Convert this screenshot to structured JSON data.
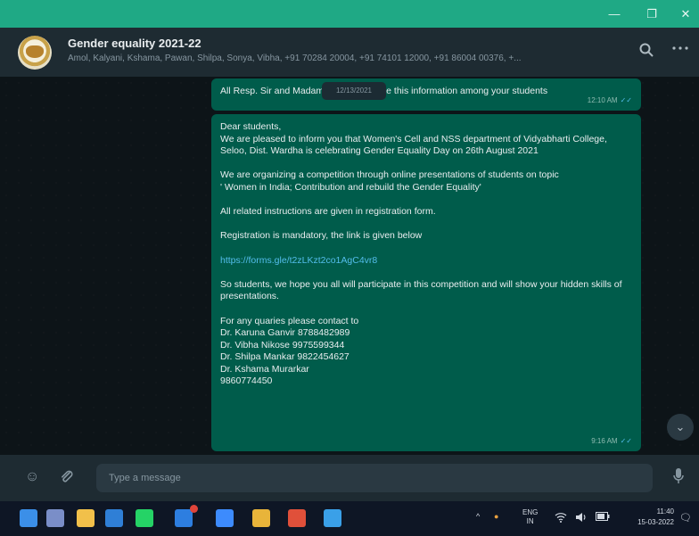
{
  "window": {
    "minimize_glyph": "—",
    "maximize_glyph": "❐",
    "close_glyph": "✕",
    "titlebar_color": "#1fa985"
  },
  "chat": {
    "title": "Gender equality 2021-22",
    "members": "Amol, Kalyani, Kshama, Pawan, Shilpa, Sonya, Vibha, +91 70284 20004, +91 74101 12000, +91 86004 00376, +...",
    "search_icon": "search-icon",
    "menu_icon": "more-options-icon"
  },
  "messages": [
    {
      "lines": [
        "All Resp. Sir and Madam please circulate this information among your students"
      ],
      "time": "12:10 AM",
      "status": "read"
    },
    {
      "lines": [
        "Dear students,",
        "We are pleased to inform you that Women's Cell and NSS department of Vidyabharti College, Seloo, Dist. Wardha is celebrating Gender Equality Day on 26th August 2021",
        "",
        "We are organizing a competition through online presentations of students on topic",
        "' Women in India; Contribution and rebuild the Gender Equality'",
        "",
        "All related instructions are given in registration form.",
        "",
        "Registration is mandatory, the link is given below",
        "",
        "https://forms.gle/t2zLKzt2co1AgC4vr8",
        "",
        "So students, we hope you all will participate in this competition and will show your hidden skills of presentations.",
        "",
        "For any quaries please contact to",
        "Dr. Karuna Ganvir 8788482989",
        "Dr. Vibha Nikose 9975599344",
        "Dr. Shilpa Mankar 9822454627",
        "Dr. Kshama Murarkar",
        "9860774450"
      ],
      "time": "9:16 AM",
      "status": "read"
    }
  ],
  "date_chip": "12/13/2021",
  "check_glyph": "✓✓",
  "scroll_down_glyph": "⌄",
  "composer": {
    "placeholder": "Type a message",
    "emoji_glyph": "☺",
    "attach_glyph": "📎",
    "mic_glyph": "🎤"
  },
  "taskbar": {
    "apps": [
      {
        "name": "start",
        "color": "#3b8fe8"
      },
      {
        "name": "search",
        "color": "#7a8ec8"
      },
      {
        "name": "file-explorer",
        "color": "#f1c04a"
      },
      {
        "name": "mail",
        "color": "#2f7fd6"
      },
      {
        "name": "whatsapp",
        "color": "#25d366"
      },
      {
        "name": "store",
        "color": "#2d7ee0"
      },
      {
        "name": "dropbox",
        "color": "#3d8bfd"
      },
      {
        "name": "chrome",
        "color": "#e8b43a"
      },
      {
        "name": "office",
        "color": "#e0503a"
      },
      {
        "name": "photos",
        "color": "#3aa0e8"
      }
    ],
    "tray_chevron": "^",
    "lang_line1": "ENG",
    "lang_line2": "IN",
    "wifi_glyph": "📶",
    "volume_glyph": "🔊",
    "battery_glyph": "🔋",
    "time": "11:40",
    "date": "15-03-2022"
  }
}
